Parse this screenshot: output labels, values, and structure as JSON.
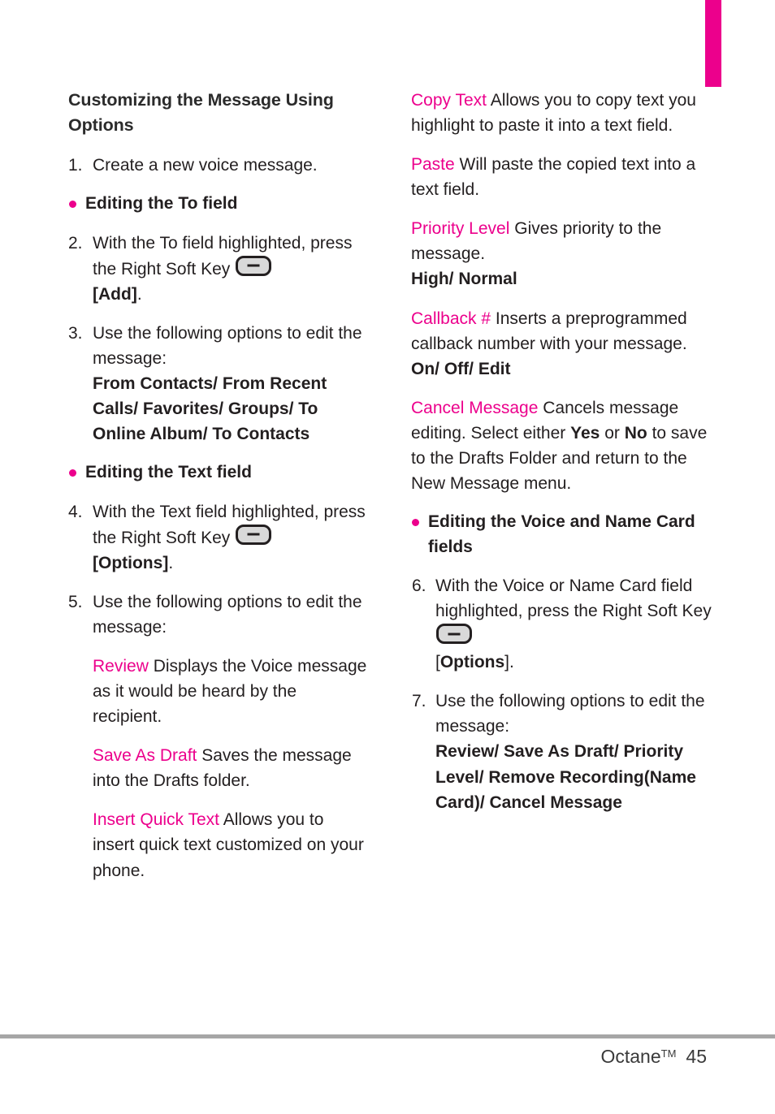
{
  "document": {
    "type": "user-manual-page",
    "accent_color": "#EC008C",
    "text_color": "#231f20",
    "rule_color": "#a6a6a6"
  },
  "section_tab": {
    "name": "section-marker",
    "color": "#EC008C"
  },
  "left_column": {
    "heading": "Customizing the Message Using Options",
    "step1": {
      "number": "1.",
      "text": "Create a new voice message."
    },
    "bullet1": "Editing the To field",
    "step2": {
      "number": "2.",
      "text_before": "With the To field highlighted, press the Right Soft Key",
      "icon": "soft-key-icon",
      "text_after": "[Add]",
      "bold_part": "[Add]",
      "trailing": "."
    },
    "step3": {
      "number": "3.",
      "text": "Use the following options to edit the message:",
      "options": "From Contacts/ From Recent Calls/ Favorites/ Groups/ To Online Album/ To Contacts"
    },
    "bullet2": "Editing the Text field",
    "step4": {
      "number": "4.",
      "text_before": "With the Text field highlighted, press the Right Soft Key",
      "icon": "soft-key-icon",
      "bold_part": "[Options]",
      "trailing": "."
    },
    "step5": {
      "number": "5.",
      "text": "Use the following options to edit the message:"
    },
    "entries": [
      {
        "term": "Review",
        "description": "Displays the Voice message as it would be heard by the recipient."
      },
      {
        "term": "Save As Draft",
        "description": "Saves the message into the Drafts folder."
      },
      {
        "term": "Insert Quick Text",
        "description": "Allows you to insert quick text customized on your phone."
      }
    ]
  },
  "right_column": {
    "entries": [
      {
        "term": "Copy Text",
        "description": "Allows you to copy text you highlight to paste it into a text field."
      },
      {
        "term": "Paste",
        "description": "Will paste the copied text into a text field."
      },
      {
        "term": "Priority Level",
        "description": "Gives priority to the message.",
        "values": "High/ Normal"
      },
      {
        "term": "Callback #",
        "description": "Inserts a preprogrammed callback number with your message.",
        "values": "On/ Off/ Edit"
      },
      {
        "term": "Cancel Message",
        "description_part1": "Cancels message editing. Select either",
        "bold1": "Yes",
        "mid": "or",
        "bold2": "No",
        "description_part2": "to save to the Drafts Folder and return to the New Message menu."
      }
    ],
    "bullet1": "Editing the Voice and Name Card fields",
    "step6": {
      "number": "6.",
      "text_before": "With the Voice or Name Card field highlighted, press the Right Soft Key",
      "icon": "soft-key-icon",
      "bracket_open": "[",
      "bold_part": "Options",
      "bracket_close": "]."
    },
    "step7": {
      "number": "7.",
      "text": "Use the following options to edit the message:",
      "options": "Review/ Save As Draft/ Priority Level/ Remove Recording(Name Card)/ Cancel Message"
    }
  },
  "footer": {
    "product": "Octane",
    "trademark": "TM",
    "page_number": "45"
  }
}
